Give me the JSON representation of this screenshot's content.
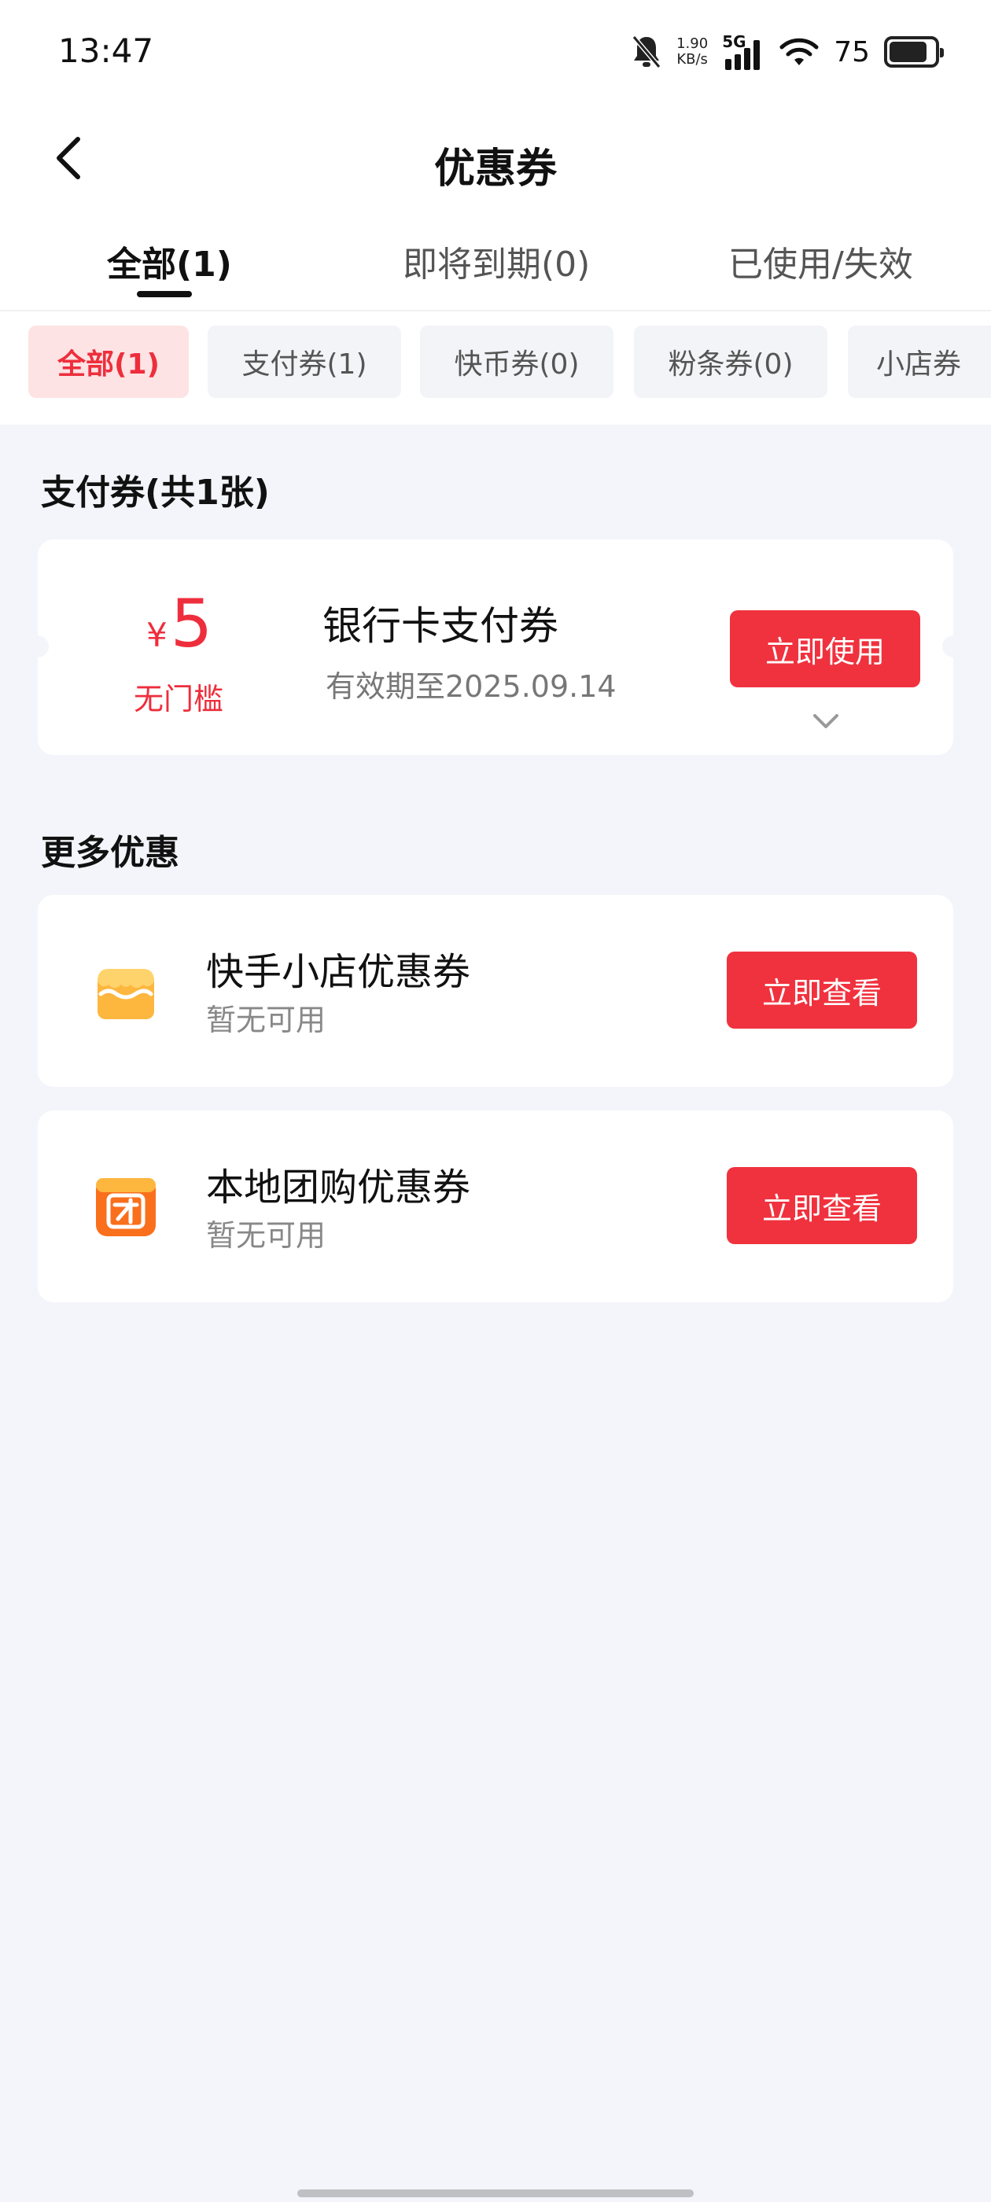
{
  "status_bar": {
    "time": "13:47",
    "net_speed_value": "1.90",
    "net_speed_unit": "KB/s",
    "signal_label": "5G",
    "battery_percent": "75",
    "icons": [
      "mute-bell-icon",
      "signal-icon",
      "wifi-icon",
      "battery-icon"
    ]
  },
  "header": {
    "title": "优惠券",
    "back_icon": "chevron-left-icon"
  },
  "tabs": [
    {
      "label": "全部(1)",
      "active": true
    },
    {
      "label": "即将到期(0)",
      "active": false
    },
    {
      "label": "已使用/失效",
      "active": false
    }
  ],
  "filters": [
    {
      "label": "全部(1)",
      "active": true
    },
    {
      "label": "支付券(1)",
      "active": false
    },
    {
      "label": "快币券(0)",
      "active": false
    },
    {
      "label": "粉条券(0)",
      "active": false
    },
    {
      "label": "小店券",
      "active": false
    }
  ],
  "payment_section": {
    "title": "支付券(共1张)",
    "coupon": {
      "currency": "¥",
      "amount": "5",
      "threshold": "无门槛",
      "name": "银行卡支付券",
      "expiry": "有效期至2025.09.14",
      "button_label": "立即使用"
    }
  },
  "more_section": {
    "title": "更多优惠",
    "items": [
      {
        "name": "快手小店优惠券",
        "status": "暂无可用",
        "button_label": "立即查看",
        "icon": "store-icon"
      },
      {
        "name": "本地团购优惠券",
        "status": "暂无可用",
        "button_label": "立即查看",
        "icon": "group-buy-icon"
      }
    ]
  },
  "colors": {
    "accent": "#f0323e",
    "chip_active_bg": "#fde3e4",
    "page_bg": "#f4f5fa",
    "store_icon": "#fdb73e",
    "group_icon": "#fa6f1c"
  }
}
